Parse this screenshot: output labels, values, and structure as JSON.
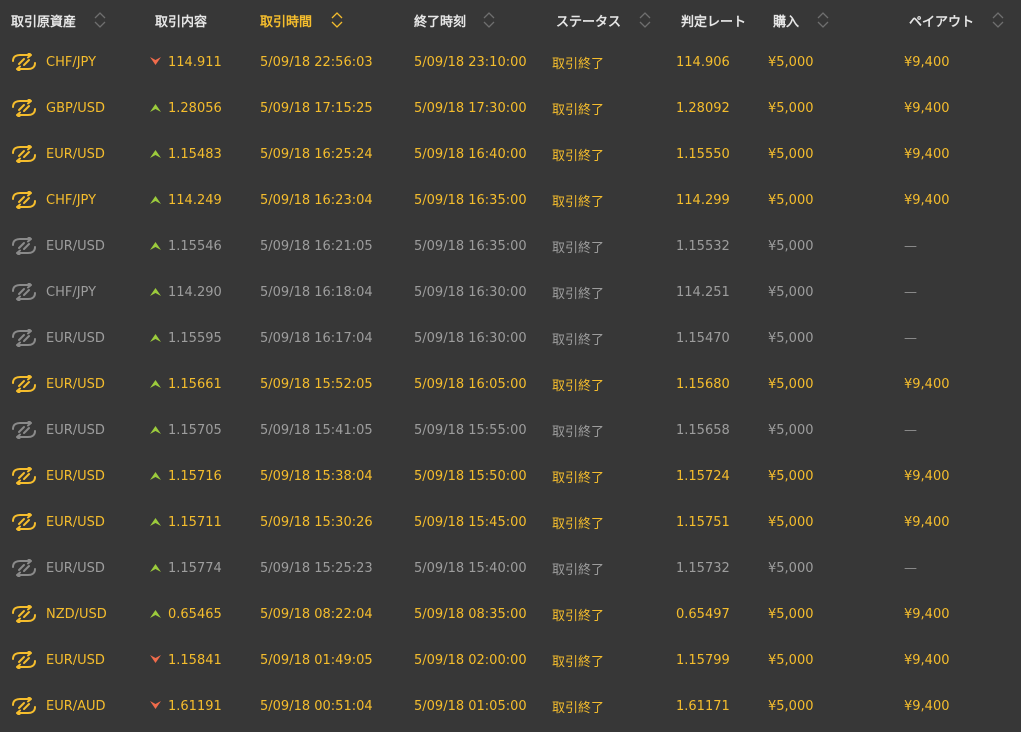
{
  "header": {
    "columns": [
      {
        "key": "asset",
        "label": "取引原資産",
        "sortable": true
      },
      {
        "key": "entry",
        "label": "取引内容",
        "sortable": false
      },
      {
        "key": "trade_time",
        "label": "取引時間",
        "sortable": true,
        "active": true
      },
      {
        "key": "end_time",
        "label": "終了時刻",
        "sortable": true
      },
      {
        "key": "status",
        "label": "ステータス",
        "sortable": true
      },
      {
        "key": "judge_rate",
        "label": "判定レート",
        "sortable": false
      },
      {
        "key": "purchase",
        "label": "購入",
        "sortable": true
      },
      {
        "key": "payout",
        "label": "ペイアウト",
        "sortable": true
      }
    ]
  },
  "colors": {
    "background": "#373737",
    "win_text": "#f5bd2d",
    "lose_text": "#9d9d9d",
    "header_text": "#e6e6e6",
    "up_arrow": "#9ccc3c",
    "down_arrow": "#f06b4b"
  },
  "icons": {
    "asset": "currency-exchange-icon",
    "up": "arrow-up-icon",
    "down": "arrow-down-icon",
    "sort": "sort-chevron-icon"
  },
  "rows": [
    {
      "asset": "CHF/JPY",
      "direction": "down",
      "entry": "114.911",
      "trade_time": "5/09/18 22:56:03",
      "end_time": "5/09/18 23:10:00",
      "status": "取引終了",
      "judge_rate": "114.906",
      "purchase": "¥5,000",
      "payout": "¥9,400",
      "result": "win"
    },
    {
      "asset": "GBP/USD",
      "direction": "up",
      "entry": "1.28056",
      "trade_time": "5/09/18 17:15:25",
      "end_time": "5/09/18 17:30:00",
      "status": "取引終了",
      "judge_rate": "1.28092",
      "purchase": "¥5,000",
      "payout": "¥9,400",
      "result": "win"
    },
    {
      "asset": "EUR/USD",
      "direction": "up",
      "entry": "1.15483",
      "trade_time": "5/09/18 16:25:24",
      "end_time": "5/09/18 16:40:00",
      "status": "取引終了",
      "judge_rate": "1.15550",
      "purchase": "¥5,000",
      "payout": "¥9,400",
      "result": "win"
    },
    {
      "asset": "CHF/JPY",
      "direction": "up",
      "entry": "114.249",
      "trade_time": "5/09/18 16:23:04",
      "end_time": "5/09/18 16:35:00",
      "status": "取引終了",
      "judge_rate": "114.299",
      "purchase": "¥5,000",
      "payout": "¥9,400",
      "result": "win"
    },
    {
      "asset": "EUR/USD",
      "direction": "up",
      "entry": "1.15546",
      "trade_time": "5/09/18 16:21:05",
      "end_time": "5/09/18 16:35:00",
      "status": "取引終了",
      "judge_rate": "1.15532",
      "purchase": "¥5,000",
      "payout": "—",
      "result": "lose"
    },
    {
      "asset": "CHF/JPY",
      "direction": "up",
      "entry": "114.290",
      "trade_time": "5/09/18 16:18:04",
      "end_time": "5/09/18 16:30:00",
      "status": "取引終了",
      "judge_rate": "114.251",
      "purchase": "¥5,000",
      "payout": "—",
      "result": "lose"
    },
    {
      "asset": "EUR/USD",
      "direction": "up",
      "entry": "1.15595",
      "trade_time": "5/09/18 16:17:04",
      "end_time": "5/09/18 16:30:00",
      "status": "取引終了",
      "judge_rate": "1.15470",
      "purchase": "¥5,000",
      "payout": "—",
      "result": "lose"
    },
    {
      "asset": "EUR/USD",
      "direction": "up",
      "entry": "1.15661",
      "trade_time": "5/09/18 15:52:05",
      "end_time": "5/09/18 16:05:00",
      "status": "取引終了",
      "judge_rate": "1.15680",
      "purchase": "¥5,000",
      "payout": "¥9,400",
      "result": "win"
    },
    {
      "asset": "EUR/USD",
      "direction": "up",
      "entry": "1.15705",
      "trade_time": "5/09/18 15:41:05",
      "end_time": "5/09/18 15:55:00",
      "status": "取引終了",
      "judge_rate": "1.15658",
      "purchase": "¥5,000",
      "payout": "—",
      "result": "lose"
    },
    {
      "asset": "EUR/USD",
      "direction": "up",
      "entry": "1.15716",
      "trade_time": "5/09/18 15:38:04",
      "end_time": "5/09/18 15:50:00",
      "status": "取引終了",
      "judge_rate": "1.15724",
      "purchase": "¥5,000",
      "payout": "¥9,400",
      "result": "win"
    },
    {
      "asset": "EUR/USD",
      "direction": "up",
      "entry": "1.15711",
      "trade_time": "5/09/18 15:30:26",
      "end_time": "5/09/18 15:45:00",
      "status": "取引終了",
      "judge_rate": "1.15751",
      "purchase": "¥5,000",
      "payout": "¥9,400",
      "result": "win"
    },
    {
      "asset": "EUR/USD",
      "direction": "up",
      "entry": "1.15774",
      "trade_time": "5/09/18 15:25:23",
      "end_time": "5/09/18 15:40:00",
      "status": "取引終了",
      "judge_rate": "1.15732",
      "purchase": "¥5,000",
      "payout": "—",
      "result": "lose"
    },
    {
      "asset": "NZD/USD",
      "direction": "up",
      "entry": "0.65465",
      "trade_time": "5/09/18 08:22:04",
      "end_time": "5/09/18 08:35:00",
      "status": "取引終了",
      "judge_rate": "0.65497",
      "purchase": "¥5,000",
      "payout": "¥9,400",
      "result": "win"
    },
    {
      "asset": "EUR/USD",
      "direction": "down",
      "entry": "1.15841",
      "trade_time": "5/09/18 01:49:05",
      "end_time": "5/09/18 02:00:00",
      "status": "取引終了",
      "judge_rate": "1.15799",
      "purchase": "¥5,000",
      "payout": "¥9,400",
      "result": "win"
    },
    {
      "asset": "EUR/AUD",
      "direction": "down",
      "entry": "1.61191",
      "trade_time": "5/09/18 00:51:04",
      "end_time": "5/09/18 01:05:00",
      "status": "取引終了",
      "judge_rate": "1.61171",
      "purchase": "¥5,000",
      "payout": "¥9,400",
      "result": "win"
    }
  ]
}
